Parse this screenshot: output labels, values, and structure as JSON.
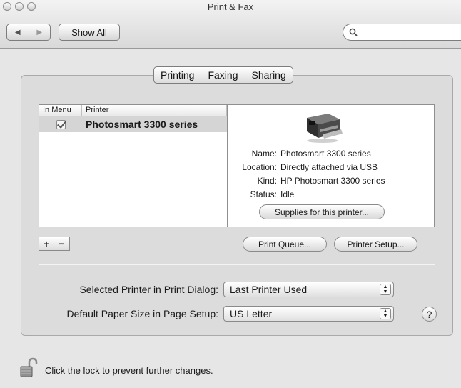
{
  "window": {
    "title": "Print & Fax"
  },
  "toolbar": {
    "back_glyph": "◀",
    "forward_glyph": "▶",
    "show_all": "Show All",
    "search_placeholder": ""
  },
  "tabs": [
    {
      "label": "Printing",
      "selected": true
    },
    {
      "label": "Faxing",
      "selected": false
    },
    {
      "label": "Sharing",
      "selected": false
    }
  ],
  "printer_list": {
    "headers": {
      "in_menu": "In Menu",
      "printer": "Printer"
    },
    "rows": [
      {
        "in_menu": true,
        "name": "Photosmart 3300 series",
        "selected": true
      }
    ]
  },
  "printer_info": {
    "icon": "printer-icon",
    "name_label": "Name:",
    "name": "Photosmart 3300 series",
    "location_label": "Location:",
    "location": "Directly attached via USB",
    "kind_label": "Kind:",
    "kind": "HP Photosmart 3300 series",
    "status_label": "Status:",
    "status": "Idle",
    "supplies_button": "Supplies for this printer..."
  },
  "list_controls": {
    "add": "+",
    "remove": "−"
  },
  "buttons": {
    "print_queue": "Print Queue...",
    "printer_setup": "Printer Setup..."
  },
  "settings": {
    "selected_printer_label": "Selected Printer in Print Dialog:",
    "selected_printer_value": "Last Printer Used",
    "paper_size_label": "Default Paper Size in Page Setup:",
    "paper_size_value": "US Letter"
  },
  "help": "?",
  "lock": {
    "icon": "unlocked-padlock-icon",
    "text": "Click the lock to prevent further changes."
  },
  "colors": {
    "window_bg": "#e6e6e6",
    "selected_row": "#d5d5d5"
  }
}
